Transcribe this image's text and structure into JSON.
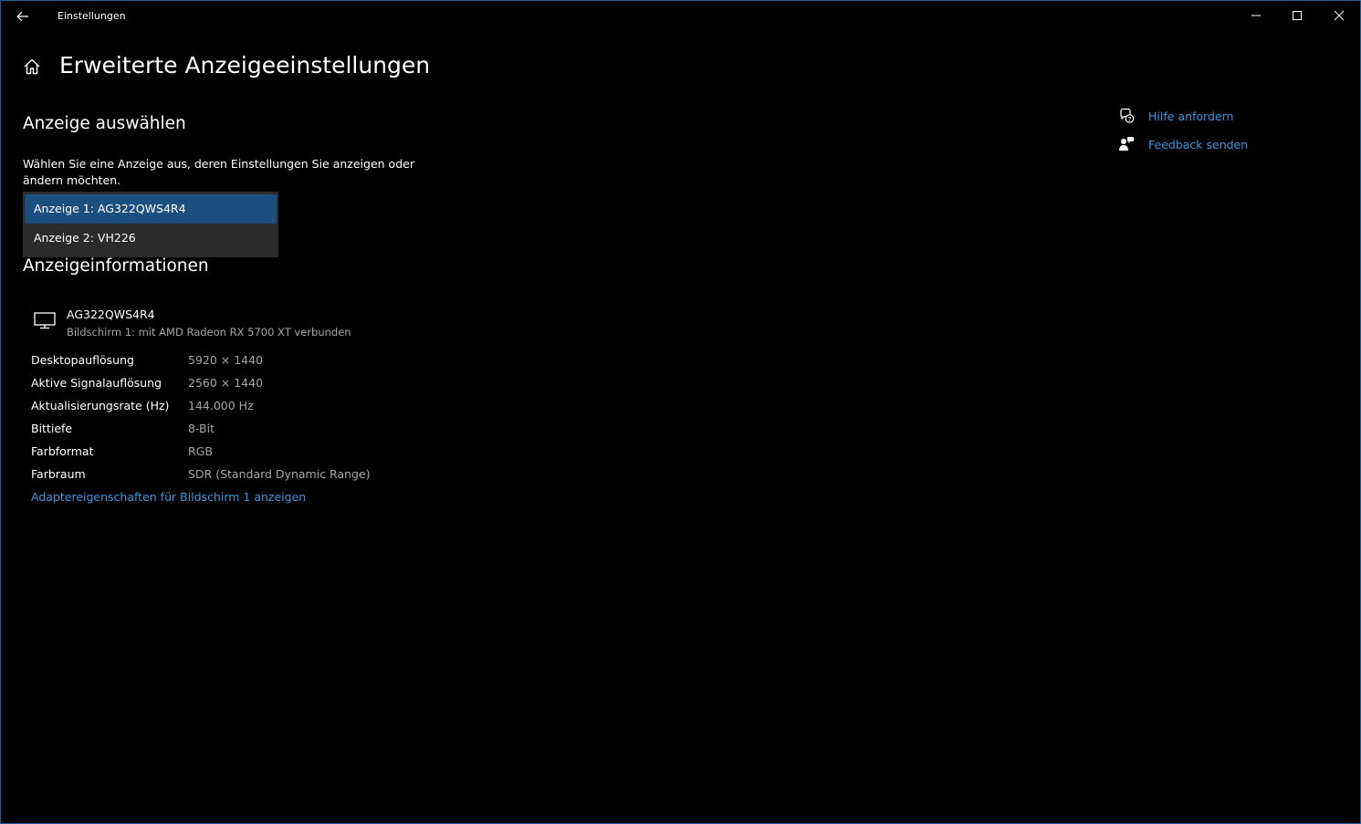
{
  "window": {
    "title": "Einstellungen",
    "accent_color": "#1f5f9e"
  },
  "header": {
    "title": "Erweiterte Anzeigeeinstellungen"
  },
  "select_display": {
    "heading": "Anzeige auswählen",
    "description": "Wählen Sie eine Anzeige aus, deren Einstellungen Sie anzeigen oder ändern möchten.",
    "options": [
      {
        "label": "Anzeige 1: AG322QWS4R4",
        "selected": true
      },
      {
        "label": "Anzeige 2: VH226",
        "selected": false
      }
    ]
  },
  "display_info": {
    "heading": "Anzeigeinformationen",
    "monitor_name": "AG322QWS4R4",
    "monitor_subtitle": "Bildschirm 1: mit AMD Radeon RX 5700 XT verbunden",
    "rows": [
      {
        "label": "Desktopauflösung",
        "value": "5920 × 1440"
      },
      {
        "label": "Aktive Signalauflösung",
        "value": "2560 × 1440"
      },
      {
        "label": "Aktualisierungsrate (Hz)",
        "value": "144.000 Hz"
      },
      {
        "label": "Bittiefe",
        "value": "8-Bit"
      },
      {
        "label": "Farbformat",
        "value": "RGB"
      },
      {
        "label": "Farbraum",
        "value": "SDR (Standard Dynamic Range)"
      }
    ],
    "adapter_link": "Adaptereigenschaften für Bildschirm 1 anzeigen"
  },
  "sidebar": {
    "links": [
      {
        "label": "Hilfe anfordern",
        "icon": "help-chat-icon"
      },
      {
        "label": "Feedback senden",
        "icon": "feedback-icon"
      }
    ]
  },
  "colors": {
    "background": "#000000",
    "link": "#3a96dd",
    "secondary_text": "#a6a6a6",
    "selected_option": "#1a4f80",
    "dropdown_bg": "#2b2b2b"
  }
}
